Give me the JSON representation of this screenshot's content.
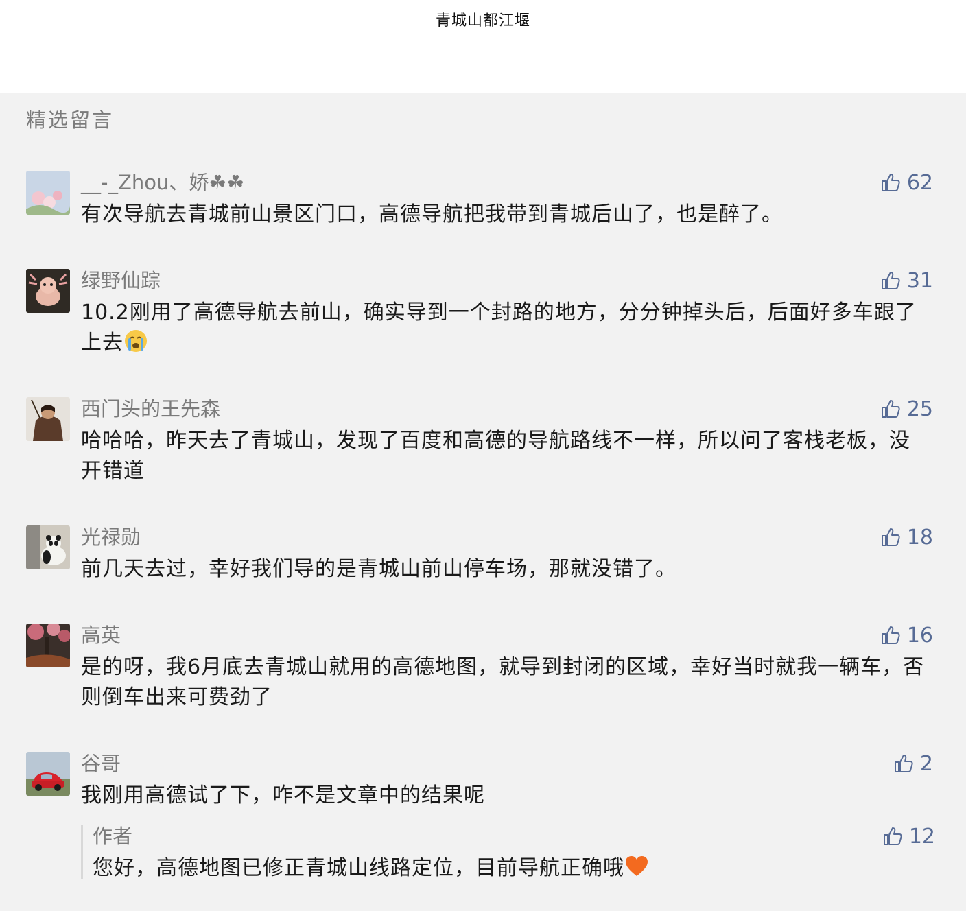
{
  "header": {
    "title": "青城山都江堰"
  },
  "section": {
    "title": "精选留言"
  },
  "comments": [
    {
      "name": "__-_Zhou、娇☘☘",
      "likes": "62",
      "text": "有次导航去青城前山景区门口，高德导航把我带到青城后山了，也是醉了。"
    },
    {
      "name": "绿野仙踪",
      "likes": "31",
      "text": "10.2刚用了高德导航去前山，确实导到一个封路的地方，分分钟掉头后，后面好多车跟了上去",
      "emoji": "crying-face"
    },
    {
      "name": "西门头的王先森",
      "likes": "25",
      "text": "哈哈哈，昨天去了青城山，发现了百度和高德的导航路线不一样，所以问了客栈老板，没开错道"
    },
    {
      "name": "光禄勋",
      "likes": "18",
      "text": "前几天去过，幸好我们导的是青城山前山停车场，那就没错了。"
    },
    {
      "name": "高英",
      "likes": "16",
      "text": "是的呀，我6月底去青城山就用的高德地图，就导到封闭的区域，幸好当时就我一辆车，否则倒车出来可费劲了"
    },
    {
      "name": "谷哥",
      "likes": "2",
      "text": "我刚用高德试了下，咋不是文章中的结果呢"
    }
  ],
  "reply": {
    "name": "作者",
    "likes": "12",
    "text": "您好，高德地图已修正青城山线路定位，目前导航正确哦",
    "emoji": "orange-heart"
  },
  "colors": {
    "accent": "#576b95",
    "background": "#f2f2f2",
    "nickname": "#7a7a7a"
  },
  "icons": {
    "like": "thumbs-up-icon"
  }
}
